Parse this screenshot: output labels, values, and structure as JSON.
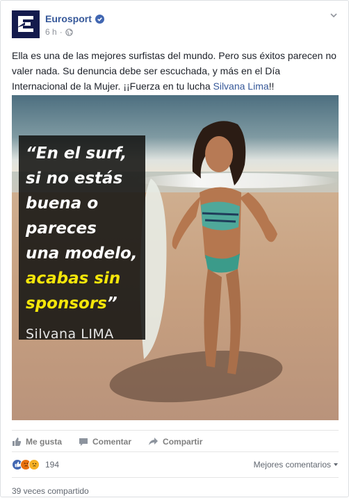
{
  "post": {
    "page_name": "Eurosport",
    "time": "6 h",
    "separator": "·",
    "text_main": "Ella es una de las mejores surfistas del mundo. Pero sus éxitos parecen no valer nada. Su denuncia debe ser escuchada, y más en el Día Internacional de la Mujer. ¡¡Fuerza en tu lucha ",
    "text_link": "Silvana Lima",
    "text_end": "!!"
  },
  "image": {
    "quote_lines": [
      "“En el surf,",
      "si no estás",
      "buena o",
      "pareces",
      "una modelo,"
    ],
    "quote_highlight": [
      "acabas sin",
      "sponsors"
    ],
    "quote_close": "”",
    "quote_author": "Silvana LIMA"
  },
  "actions": {
    "like": "Me gusta",
    "comment": "Comentar",
    "share": "Compartir"
  },
  "reactions": {
    "count": "194",
    "sort_label": "Mejores comentarios",
    "shares": "39 veces compartido"
  },
  "colors": {
    "link": "#365899",
    "logo_bg": "#141b4d",
    "like_blue": "#4267b2",
    "angry": "#e9710f",
    "sad": "#f7b125",
    "highlight": "#f5e60a"
  },
  "icons": {
    "verified": "verified-badge-icon",
    "globe": "globe-icon",
    "chevron": "chevron-down-icon",
    "like": "thumbs-up-icon",
    "comment": "speech-bubble-icon",
    "share": "share-arrow-icon"
  }
}
